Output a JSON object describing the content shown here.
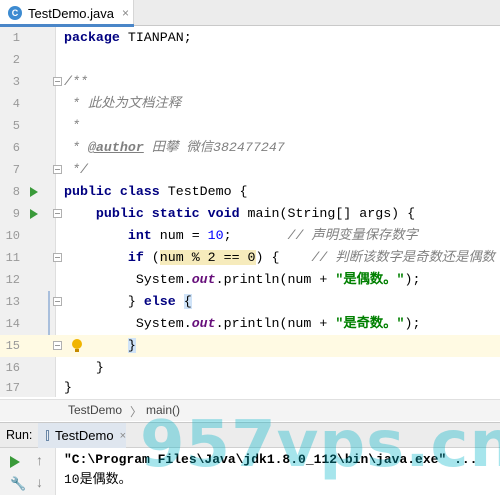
{
  "tab": {
    "label": "TestDemo.java",
    "icon": "class-icon",
    "close": "×"
  },
  "lines": [
    {
      "num": "1"
    },
    {
      "num": "2"
    },
    {
      "num": "3"
    },
    {
      "num": "4"
    },
    {
      "num": "5"
    },
    {
      "num": "6"
    },
    {
      "num": "7"
    },
    {
      "num": "8"
    },
    {
      "num": "9"
    },
    {
      "num": "10"
    },
    {
      "num": "11"
    },
    {
      "num": "12"
    },
    {
      "num": "13"
    },
    {
      "num": "14"
    },
    {
      "num": "15"
    },
    {
      "num": "16"
    },
    {
      "num": "17"
    }
  ],
  "code": {
    "l1_kw": "package",
    "l1_rest": " TIANPAN;",
    "l4": "/**",
    "l5": " * 此处为文档注释",
    "l6": " *",
    "l7_prefix": " * ",
    "l7_tag": "@author",
    "l7_rest": " 田攀 微信382477247",
    "l8": " */",
    "l9_kw": "public class",
    "l9_rest": " TestDemo {",
    "l10_kw": "public static void",
    "l10_rest": " main(String[] args) {",
    "l11_kw": "int",
    "l11_mid": " num = ",
    "l11_num": "10",
    "l11_end": ";",
    "l11_cmt": "// 声明变量保存数字",
    "l12_kw": "if",
    "l12_a": " (",
    "l12_hl": "num % 2 == 0",
    "l12_b": ") {",
    "l12_cmt": "// 判断该数字是奇数还是偶数",
    "l13_a": "System.",
    "l13_field": "out",
    "l13_b": ".println(num + ",
    "l13_str": "\"是偶数。\"",
    "l13_c": ");",
    "l14_a": "} ",
    "l14_kw": "else",
    "l14_b": " ",
    "l14_brace": "{",
    "l15_a": "System.",
    "l15_field": "out",
    "l15_b": ".println(num + ",
    "l15_str": "\"是奇数。\"",
    "l15_c": ");",
    "l16_brace": "}",
    "l17": "}",
    "l18": "}"
  },
  "breadcrumb": {
    "class": "TestDemo",
    "separator": "〉",
    "method": "main()"
  },
  "run": {
    "title": "Run:",
    "tab_label": "TestDemo",
    "tab_close": "×",
    "command": "\"C:\\Program Files\\Java\\jdk1.8.0_112\\bin\\java.exe\" ...",
    "output": "10是偶数。"
  },
  "watermark": "957vps.cn",
  "colors": {
    "keyword": "#000080",
    "string": "#008000",
    "comment": "#808080",
    "number": "#0000ff",
    "run": "#3a9a3a",
    "tab_accent": "#4a86c8"
  }
}
